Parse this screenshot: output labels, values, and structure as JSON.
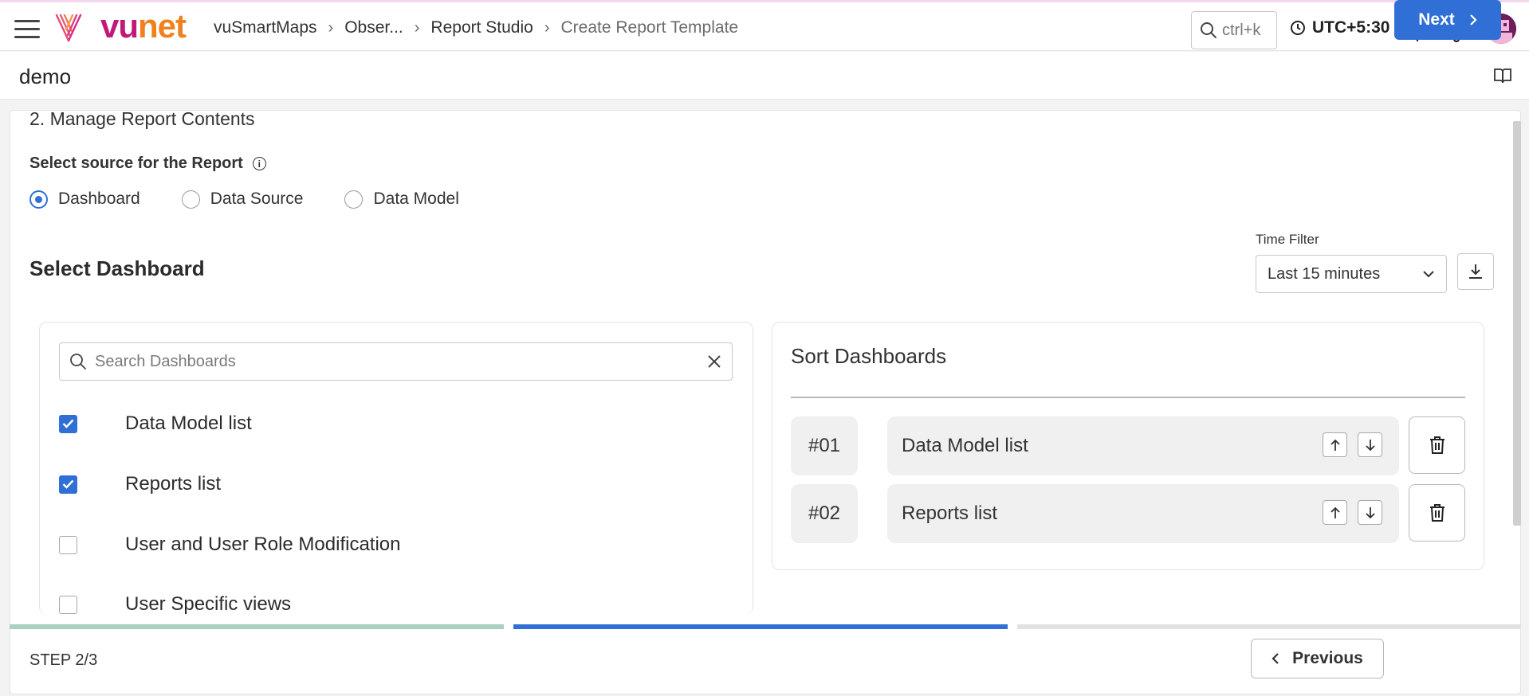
{
  "header": {
    "logo_text_vu": "vu",
    "logo_text_net": "net",
    "breadcrumb": [
      "vuSmartMaps",
      "Obser...",
      "Report Studio",
      "Create Report Template"
    ],
    "search_placeholder": "ctrl+k",
    "timezone": "UTC+5:30"
  },
  "page": {
    "title": "demo"
  },
  "form": {
    "step_title": "2. Manage Report Contents",
    "source_label": "Select source for the Report",
    "info_glyph": "i",
    "sources": [
      "Dashboard",
      "Data Source",
      "Data Model"
    ],
    "selected_source": "Dashboard",
    "select_dashboard_heading": "Select Dashboard",
    "time_filter_label": "Time Filter",
    "time_filter_value": "Last 15 minutes"
  },
  "dashboards": {
    "search_placeholder": "Search Dashboards",
    "items": [
      {
        "label": "Data Model list",
        "checked": true
      },
      {
        "label": "Reports list",
        "checked": true
      },
      {
        "label": "User and User Role Modification",
        "checked": false
      },
      {
        "label": "User Specific views",
        "checked": false
      }
    ]
  },
  "sort": {
    "title": "Sort Dashboards",
    "rows": [
      {
        "num": "#01",
        "name": "Data Model list"
      },
      {
        "num": "#02",
        "name": "Reports list"
      }
    ]
  },
  "footer": {
    "step_text": "STEP 2/3",
    "previous_label": "Previous",
    "next_label": "Next",
    "current_step": 2,
    "total_steps": 3
  },
  "colors": {
    "accent": "#2f6fd6",
    "step_done": "#a9d1c0",
    "step_pending": "#e2e2e2",
    "brand_magenta": "#c2187a",
    "brand_orange": "#f0821e"
  }
}
